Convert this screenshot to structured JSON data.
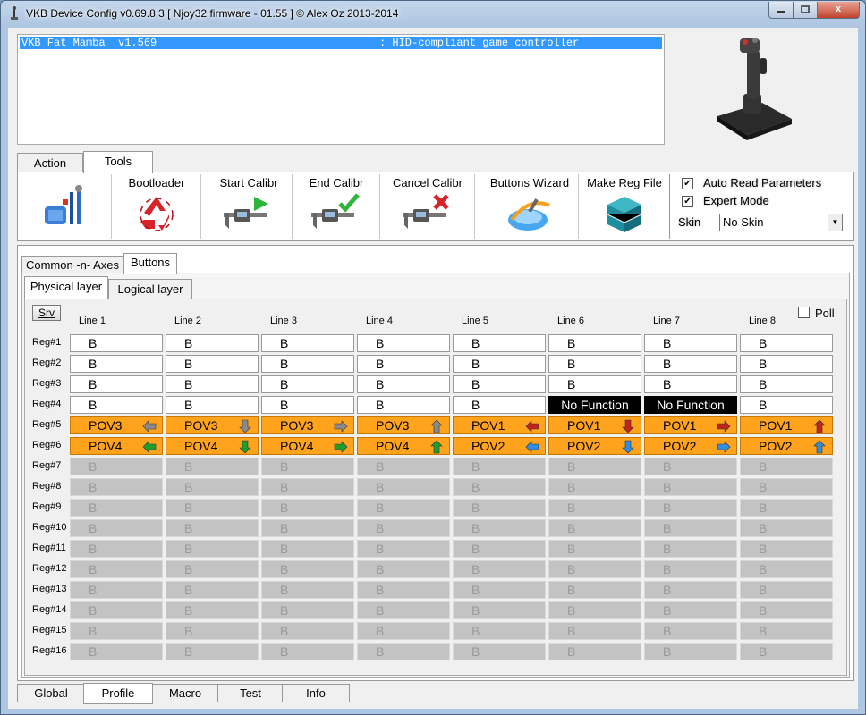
{
  "window": {
    "title": "VKB Device Config v0.69.8.3 [ Njoy32 firmware - 01.55 ] © Alex Oz 2013-2014",
    "close": "x"
  },
  "device_list": {
    "name": "VKB Fat Mamba  v1.569",
    "type": ": HID-compliant game controller"
  },
  "top_tabs": [
    "Action",
    "Tools"
  ],
  "tools": {
    "bootloader": "Bootloader",
    "start_calibr": "Start Calibr",
    "end_calibr": "End Calibr",
    "cancel_calibr": "Cancel Calibr",
    "buttons_wizard": "Buttons Wizard",
    "make_reg_file": "Make Reg File"
  },
  "options": {
    "auto_read": {
      "label": "Auto Read Parameters",
      "checked": true
    },
    "expert_mode": {
      "label": "Expert Mode",
      "checked": true
    },
    "skin_label": "Skin",
    "skin_value": "No Skin"
  },
  "sub_tabs": [
    "Common -n- Axes",
    "Buttons"
  ],
  "layer_tabs": [
    "Physical layer",
    "Logical layer"
  ],
  "srv_label": "Srv",
  "poll_label": "Poll",
  "columns": [
    "Line 1",
    "Line 2",
    "Line 3",
    "Line 4",
    "Line 5",
    "Line 6",
    "Line 7",
    "Line 8"
  ],
  "rows": [
    {
      "label": "Reg#1",
      "cells": [
        {
          "t": "B"
        },
        {
          "t": "B"
        },
        {
          "t": "B"
        },
        {
          "t": "B"
        },
        {
          "t": "B"
        },
        {
          "t": "B"
        },
        {
          "t": "B"
        },
        {
          "t": "B"
        }
      ]
    },
    {
      "label": "Reg#2",
      "cells": [
        {
          "t": "B"
        },
        {
          "t": "B"
        },
        {
          "t": "B"
        },
        {
          "t": "B"
        },
        {
          "t": "B"
        },
        {
          "t": "B"
        },
        {
          "t": "B"
        },
        {
          "t": "B"
        }
      ]
    },
    {
      "label": "Reg#3",
      "cells": [
        {
          "t": "B"
        },
        {
          "t": "B"
        },
        {
          "t": "B"
        },
        {
          "t": "B"
        },
        {
          "t": "B"
        },
        {
          "t": "B"
        },
        {
          "t": "B"
        },
        {
          "t": "B"
        }
      ]
    },
    {
      "label": "Reg#4",
      "cells": [
        {
          "t": "B"
        },
        {
          "t": "B"
        },
        {
          "t": "B"
        },
        {
          "t": "B"
        },
        {
          "t": "B"
        },
        {
          "t": "No Function",
          "k": "nf"
        },
        {
          "t": "No Function",
          "k": "nf"
        },
        {
          "t": "B"
        }
      ]
    },
    {
      "label": "Reg#5",
      "cells": [
        {
          "t": "POV3",
          "k": "pov",
          "dir": "left",
          "color": "#8a8a8a"
        },
        {
          "t": "POV3",
          "k": "pov",
          "dir": "down",
          "color": "#8a8a8a"
        },
        {
          "t": "POV3",
          "k": "pov",
          "dir": "right",
          "color": "#8a8a8a"
        },
        {
          "t": "POV3",
          "k": "pov",
          "dir": "up",
          "color": "#8a8a8a"
        },
        {
          "t": "POV1",
          "k": "pov",
          "dir": "left",
          "color": "#c0241a"
        },
        {
          "t": "POV1",
          "k": "pov",
          "dir": "down",
          "color": "#c0241a"
        },
        {
          "t": "POV1",
          "k": "pov",
          "dir": "right",
          "color": "#c0241a"
        },
        {
          "t": "POV1",
          "k": "pov",
          "dir": "up",
          "color": "#c0241a"
        }
      ]
    },
    {
      "label": "Reg#6",
      "cells": [
        {
          "t": "POV4",
          "k": "pov",
          "dir": "left",
          "color": "#1f9e2c"
        },
        {
          "t": "POV4",
          "k": "pov",
          "dir": "down",
          "color": "#1f9e2c"
        },
        {
          "t": "POV4",
          "k": "pov",
          "dir": "right",
          "color": "#1f9e2c"
        },
        {
          "t": "POV4",
          "k": "pov",
          "dir": "up",
          "color": "#1f9e2c"
        },
        {
          "t": "POV2",
          "k": "pov",
          "dir": "left",
          "color": "#2f8ee0"
        },
        {
          "t": "POV2",
          "k": "pov",
          "dir": "down",
          "color": "#2f8ee0"
        },
        {
          "t": "POV2",
          "k": "pov",
          "dir": "right",
          "color": "#2f8ee0"
        },
        {
          "t": "POV2",
          "k": "pov",
          "dir": "up",
          "color": "#2f8ee0"
        }
      ]
    },
    {
      "label": "Reg#7",
      "cells": [
        {
          "t": "B",
          "k": "dis"
        },
        {
          "t": "B",
          "k": "dis"
        },
        {
          "t": "B",
          "k": "dis"
        },
        {
          "t": "B",
          "k": "dis"
        },
        {
          "t": "B",
          "k": "dis"
        },
        {
          "t": "B",
          "k": "dis"
        },
        {
          "t": "B",
          "k": "dis"
        },
        {
          "t": "B",
          "k": "dis"
        }
      ]
    },
    {
      "label": "Reg#8",
      "cells": [
        {
          "t": "B",
          "k": "dis"
        },
        {
          "t": "B",
          "k": "dis"
        },
        {
          "t": "B",
          "k": "dis"
        },
        {
          "t": "B",
          "k": "dis"
        },
        {
          "t": "B",
          "k": "dis"
        },
        {
          "t": "B",
          "k": "dis"
        },
        {
          "t": "B",
          "k": "dis"
        },
        {
          "t": "B",
          "k": "dis"
        }
      ]
    },
    {
      "label": "Reg#9",
      "cells": [
        {
          "t": "B",
          "k": "dis"
        },
        {
          "t": "B",
          "k": "dis"
        },
        {
          "t": "B",
          "k": "dis"
        },
        {
          "t": "B",
          "k": "dis"
        },
        {
          "t": "B",
          "k": "dis"
        },
        {
          "t": "B",
          "k": "dis"
        },
        {
          "t": "B",
          "k": "dis"
        },
        {
          "t": "B",
          "k": "dis"
        }
      ]
    },
    {
      "label": "Reg#10",
      "cells": [
        {
          "t": "B",
          "k": "dis"
        },
        {
          "t": "B",
          "k": "dis"
        },
        {
          "t": "B",
          "k": "dis"
        },
        {
          "t": "B",
          "k": "dis"
        },
        {
          "t": "B",
          "k": "dis"
        },
        {
          "t": "B",
          "k": "dis"
        },
        {
          "t": "B",
          "k": "dis"
        },
        {
          "t": "B",
          "k": "dis"
        }
      ]
    },
    {
      "label": "Reg#11",
      "cells": [
        {
          "t": "B",
          "k": "dis"
        },
        {
          "t": "B",
          "k": "dis"
        },
        {
          "t": "B",
          "k": "dis"
        },
        {
          "t": "B",
          "k": "dis"
        },
        {
          "t": "B",
          "k": "dis"
        },
        {
          "t": "B",
          "k": "dis"
        },
        {
          "t": "B",
          "k": "dis"
        },
        {
          "t": "B",
          "k": "dis"
        }
      ]
    },
    {
      "label": "Reg#12",
      "cells": [
        {
          "t": "B",
          "k": "dis"
        },
        {
          "t": "B",
          "k": "dis"
        },
        {
          "t": "B",
          "k": "dis"
        },
        {
          "t": "B",
          "k": "dis"
        },
        {
          "t": "B",
          "k": "dis"
        },
        {
          "t": "B",
          "k": "dis"
        },
        {
          "t": "B",
          "k": "dis"
        },
        {
          "t": "B",
          "k": "dis"
        }
      ]
    },
    {
      "label": "Reg#13",
      "cells": [
        {
          "t": "B",
          "k": "dis"
        },
        {
          "t": "B",
          "k": "dis"
        },
        {
          "t": "B",
          "k": "dis"
        },
        {
          "t": "B",
          "k": "dis"
        },
        {
          "t": "B",
          "k": "dis"
        },
        {
          "t": "B",
          "k": "dis"
        },
        {
          "t": "B",
          "k": "dis"
        },
        {
          "t": "B",
          "k": "dis"
        }
      ]
    },
    {
      "label": "Reg#14",
      "cells": [
        {
          "t": "B",
          "k": "dis"
        },
        {
          "t": "B",
          "k": "dis"
        },
        {
          "t": "B",
          "k": "dis"
        },
        {
          "t": "B",
          "k": "dis"
        },
        {
          "t": "B",
          "k": "dis"
        },
        {
          "t": "B",
          "k": "dis"
        },
        {
          "t": "B",
          "k": "dis"
        },
        {
          "t": "B",
          "k": "dis"
        }
      ]
    },
    {
      "label": "Reg#15",
      "cells": [
        {
          "t": "B",
          "k": "dis"
        },
        {
          "t": "B",
          "k": "dis"
        },
        {
          "t": "B",
          "k": "dis"
        },
        {
          "t": "B",
          "k": "dis"
        },
        {
          "t": "B",
          "k": "dis"
        },
        {
          "t": "B",
          "k": "dis"
        },
        {
          "t": "B",
          "k": "dis"
        },
        {
          "t": "B",
          "k": "dis"
        }
      ]
    },
    {
      "label": "Reg#16",
      "cells": [
        {
          "t": "B",
          "k": "dis"
        },
        {
          "t": "B",
          "k": "dis"
        },
        {
          "t": "B",
          "k": "dis"
        },
        {
          "t": "B",
          "k": "dis"
        },
        {
          "t": "B",
          "k": "dis"
        },
        {
          "t": "B",
          "k": "dis"
        },
        {
          "t": "B",
          "k": "dis"
        },
        {
          "t": "B",
          "k": "dis"
        }
      ]
    }
  ],
  "bottom_tabs": [
    "Global",
    "Profile",
    "Macro",
    "Test",
    "Info"
  ],
  "selected": {
    "top_tab": "Tools",
    "sub_tab": "Buttons",
    "layer_tab": "Physical layer",
    "bottom_tab": "Profile"
  }
}
